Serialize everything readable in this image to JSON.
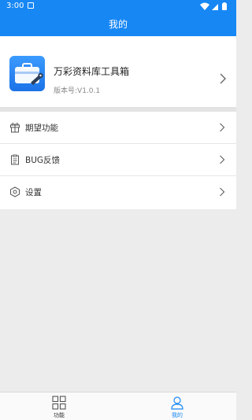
{
  "status_bar": {
    "time": "3:00"
  },
  "header": {
    "title": "我的"
  },
  "app": {
    "name": "万彩资料库工具箱",
    "version": "版本号:V1.0.1",
    "icon": "toolbox-icon"
  },
  "menu": [
    {
      "label": "期望功能",
      "icon": "gift-icon"
    },
    {
      "label": "BUG反馈",
      "icon": "clipboard-icon"
    },
    {
      "label": "设置",
      "icon": "settings-icon"
    }
  ],
  "tabbar": {
    "tabs": [
      {
        "label": "功能",
        "icon": "grid-icon",
        "active": false
      },
      {
        "label": "我的",
        "icon": "user-icon",
        "active": true
      }
    ]
  },
  "colors": {
    "primary": "#1787f4",
    "background": "#ececec"
  }
}
